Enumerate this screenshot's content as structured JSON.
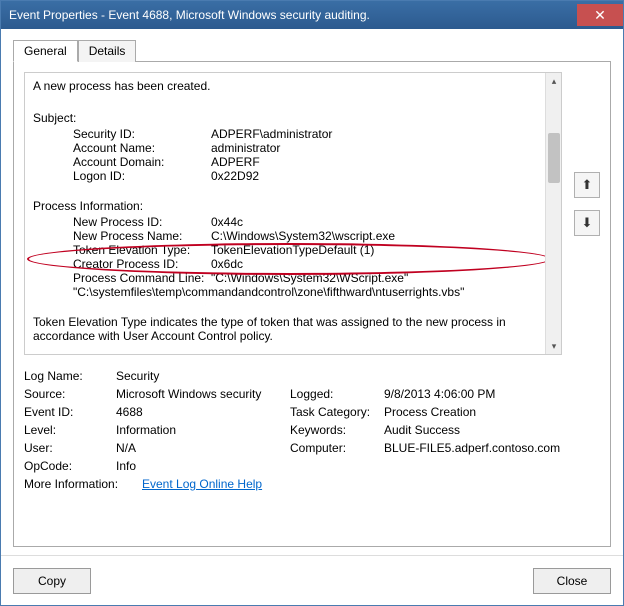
{
  "window": {
    "title": "Event Properties - Event 4688, Microsoft Windows security auditing.",
    "close_glyph": "✕"
  },
  "tabs": {
    "general": "General",
    "details": "Details"
  },
  "description": {
    "line1": "A new process has been created.",
    "subject_header": "Subject:",
    "subject": {
      "security_id_lbl": "Security ID:",
      "security_id_val": "ADPERF\\administrator",
      "account_name_lbl": "Account Name:",
      "account_name_val": "administrator",
      "account_domain_lbl": "Account Domain:",
      "account_domain_val": "ADPERF",
      "logon_id_lbl": "Logon ID:",
      "logon_id_val": "0x22D92"
    },
    "process_header": "Process Information:",
    "process": {
      "new_pid_lbl": "New Process ID:",
      "new_pid_val": "0x44c",
      "new_pname_lbl": "New Process Name:",
      "new_pname_val": "C:\\Windows\\System32\\wscript.exe",
      "tet_lbl": "Token Elevation Type:",
      "tet_val": "TokenElevationTypeDefault (1)",
      "creator_pid_lbl": "Creator Process ID:",
      "creator_pid_val": "0x6dc",
      "cmdline_lbl": "Process Command Line:",
      "cmdline_val": "\"C:\\Windows\\System32\\WScript.exe\" \"C:\\systemfiles\\temp\\commandandcontrol\\zone\\fifthward\\ntuserrights.vbs\""
    },
    "tet_note": "Token Elevation Type indicates the type of token that was assigned to the new process in accordance with User Account Control policy."
  },
  "meta": {
    "log_name_lbl": "Log Name:",
    "log_name_val": "Security",
    "source_lbl": "Source:",
    "source_val": "Microsoft Windows security",
    "logged_lbl": "Logged:",
    "logged_val": "9/8/2013 4:06:00 PM",
    "event_id_lbl": "Event ID:",
    "event_id_val": "4688",
    "task_cat_lbl": "Task Category:",
    "task_cat_val": "Process Creation",
    "level_lbl": "Level:",
    "level_val": "Information",
    "keywords_lbl": "Keywords:",
    "keywords_val": "Audit Success",
    "user_lbl": "User:",
    "user_val": "N/A",
    "computer_lbl": "Computer:",
    "computer_val": "BLUE-FILE5.adperf.contoso.com",
    "opcode_lbl": "OpCode:",
    "opcode_val": "Info",
    "moreinfo_lbl": "More Information:",
    "moreinfo_link": "Event Log Online Help"
  },
  "footer": {
    "copy": "Copy",
    "close": "Close"
  },
  "nav": {
    "up": "⬆",
    "down": "⬇"
  }
}
